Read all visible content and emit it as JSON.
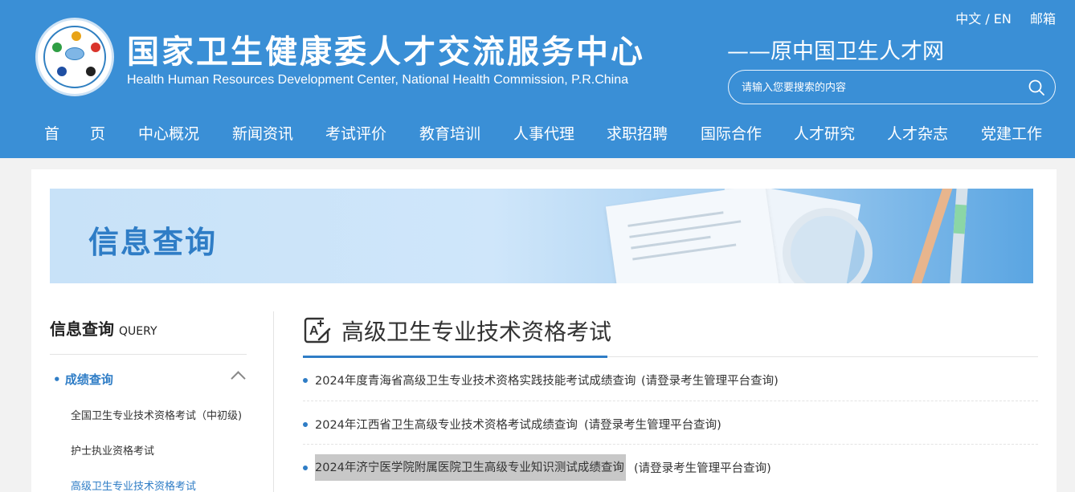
{
  "header": {
    "site_name_cn": "国家卫生健康委人才交流服务中心",
    "site_name_en": "Health Human Resources Development Center, National Health Commission, P.R.China",
    "site_subtitle": "——原中国卫生人才网",
    "lang_switch": "中文 / EN",
    "mail": "邮箱",
    "search_placeholder": "请输入您要搜索的内容"
  },
  "nav": {
    "items": [
      "首　　页",
      "中心概况",
      "新闻资讯",
      "考试评价",
      "教育培训",
      "人事代理",
      "求职招聘",
      "国际合作",
      "人才研究",
      "人才杂志",
      "党建工作"
    ]
  },
  "banner": {
    "title": "信息查询"
  },
  "sidebar": {
    "title": "信息查询",
    "title_en": "QUERY",
    "category": "成绩查询",
    "sub_items": [
      "全国卫生专业技术资格考试（中初级)",
      "护士执业资格考试",
      "高级卫生专业技术资格考试"
    ]
  },
  "main": {
    "title": "高级卫生专业技术资格考试",
    "list": [
      {
        "title": "2024年度青海省高级卫生专业技术资格实践技能考试成绩查询",
        "note": "(请登录考生管理平台查询)"
      },
      {
        "title": "2024年江西省卫生高级专业技术资格考试成绩查询",
        "note": "(请登录考生管理平台查询)"
      },
      {
        "title": "2024年济宁医学院附属医院卫生高级专业知识测试成绩查询",
        "note": "(请登录考生管理平台查询)"
      }
    ]
  },
  "colors": {
    "header_bg": "#3a8fd6",
    "accent": "#2f7dc6"
  }
}
